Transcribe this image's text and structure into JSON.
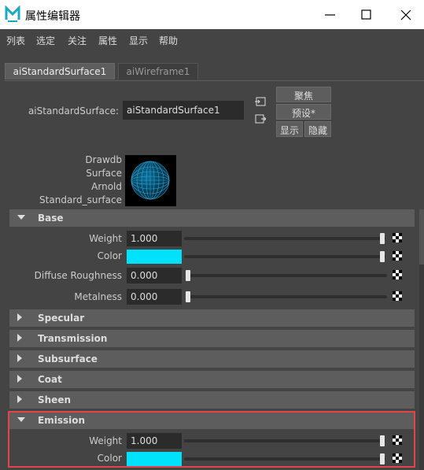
{
  "window": {
    "title": "属性编辑器",
    "app_icon_letter": "M"
  },
  "menu": [
    "列表",
    "选定",
    "关注",
    "属性",
    "显示",
    "帮助"
  ],
  "tabs": [
    {
      "label": "aiStandardSurface1",
      "active": true
    },
    {
      "label": "aiWireframe1",
      "active": false
    }
  ],
  "node": {
    "type_label": "aiStandardSurface:",
    "name_value": "aiStandardSurface1"
  },
  "buttons": {
    "focus": "聚焦",
    "presets": "预设*",
    "show": "显示",
    "hide": "隐藏"
  },
  "swatch_labels": [
    "Drawdb",
    "Surface",
    "Arnold",
    "Standard_surface"
  ],
  "sections": {
    "base": {
      "title": "Base",
      "expanded": true
    },
    "specular": {
      "title": "Specular",
      "expanded": false
    },
    "transmission": {
      "title": "Transmission",
      "expanded": false
    },
    "subsurface": {
      "title": "Subsurface",
      "expanded": false
    },
    "coat": {
      "title": "Coat",
      "expanded": false
    },
    "sheen": {
      "title": "Sheen",
      "expanded": false
    },
    "emission": {
      "title": "Emission",
      "expanded": true
    }
  },
  "base_attrs": {
    "weight": {
      "label": "Weight",
      "value": "1.000",
      "slider": 1.0
    },
    "color": {
      "label": "Color",
      "color": "#00e1fb",
      "slider": 1.0
    },
    "diffuse_roughness": {
      "label": "Diffuse Roughness",
      "value": "0.000",
      "slider": 0.0
    },
    "metalness": {
      "label": "Metalness",
      "value": "0.000",
      "slider": 0.0
    }
  },
  "emission_attrs": {
    "weight": {
      "label": "Weight",
      "value": "1.000",
      "slider": 1.0
    },
    "color": {
      "label": "Color",
      "color": "#00e1fb",
      "slider": 1.0
    }
  },
  "colors": {
    "accent_cyan": "#00e1fb",
    "highlight_red": "#e0454b",
    "panel_bg": "#444444"
  }
}
